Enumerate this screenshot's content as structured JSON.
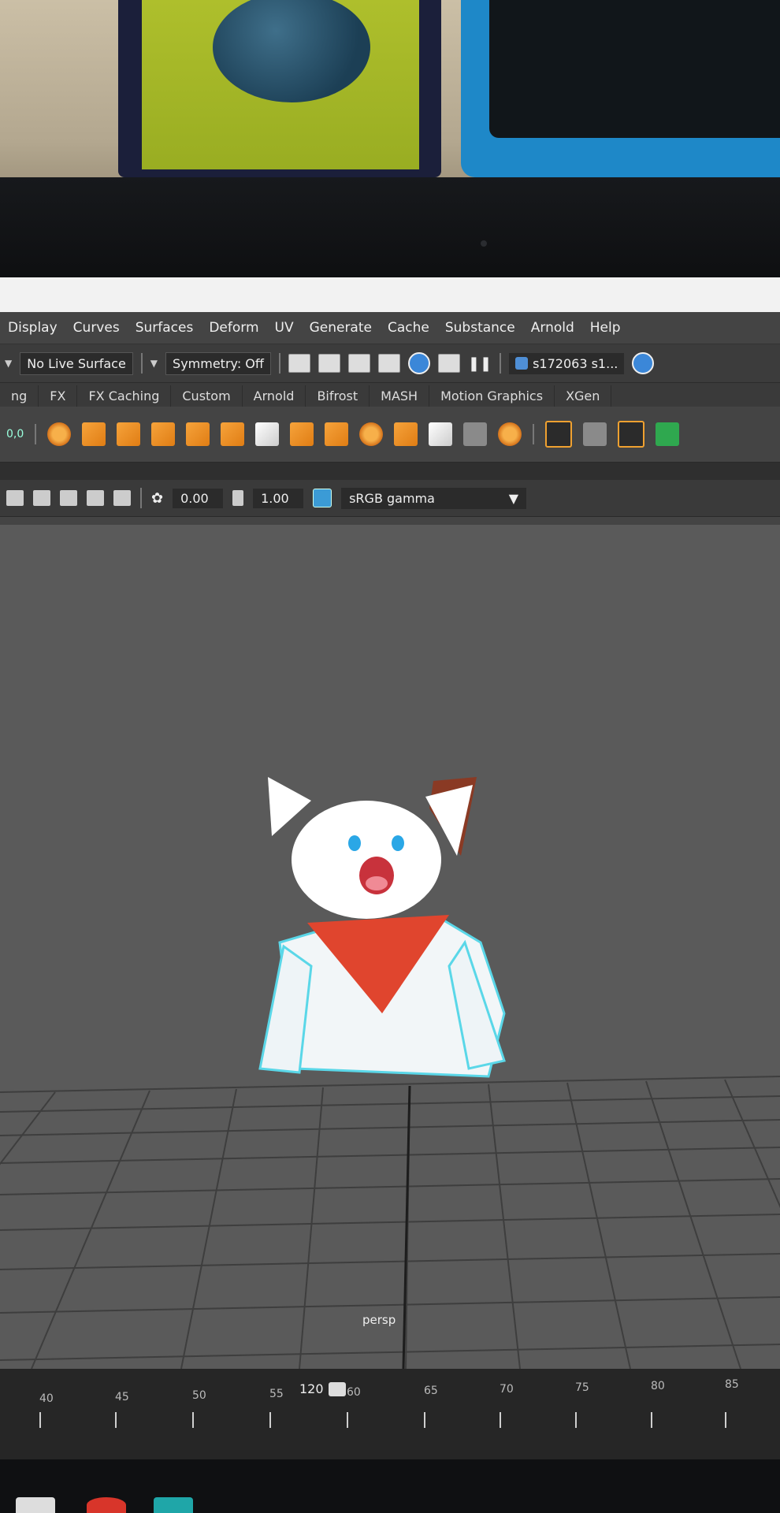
{
  "menu": [
    "Display",
    "Curves",
    "Surfaces",
    "Deform",
    "UV",
    "Generate",
    "Cache",
    "Substance",
    "Arnold",
    "Help"
  ],
  "status": {
    "live_surface": "No Live Surface",
    "symmetry": "Symmetry: Off",
    "user": "s172063 s1...",
    "pivot_readout": "0,0"
  },
  "shelf_tabs": [
    "ng",
    "FX",
    "FX Caching",
    "Custom",
    "Arnold",
    "Bifrost",
    "MASH",
    "Motion Graphics",
    "XGen"
  ],
  "panel": {
    "exposure": "0.00",
    "gamma": "1.00",
    "color_space": "sRGB gamma"
  },
  "viewport": {
    "camera_label": "persp"
  },
  "timeline": {
    "ticks": [
      "40",
      "45",
      "50",
      "55",
      "60",
      "65",
      "70",
      "75",
      "80",
      "85"
    ],
    "range_end": "120"
  },
  "colors": {
    "accent": "#f0a130",
    "viewport_bg": "#5a5a5a",
    "cape": "#e0452e",
    "eyes": "#2aa7e6"
  }
}
